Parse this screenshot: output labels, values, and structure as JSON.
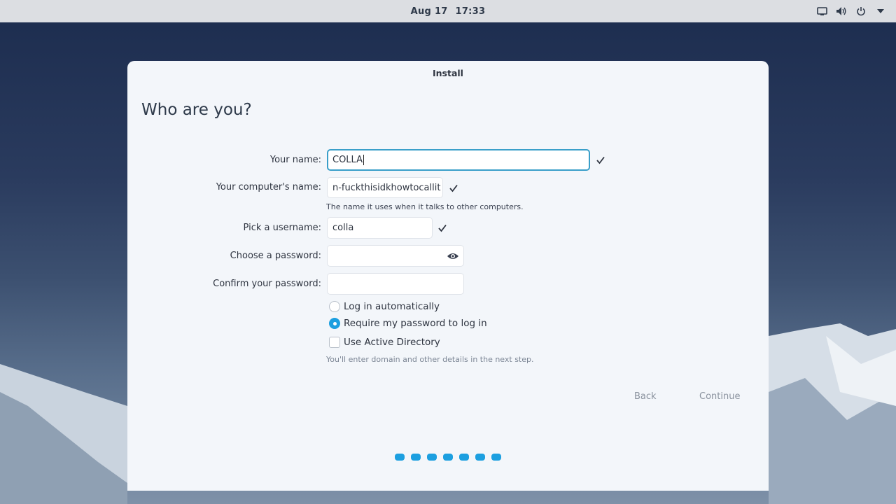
{
  "topbar": {
    "date": "Aug 17",
    "time": "17:33",
    "icons": [
      "display-icon",
      "volume-icon",
      "power-icon",
      "menu-arrow-icon"
    ]
  },
  "window": {
    "title": "Install",
    "heading": "Who are you?"
  },
  "form": {
    "name_label": "Your name:",
    "name_value": "COLLA",
    "computer_label": "Your computer's name:",
    "computer_value": "n-fuckthisidkhowtocallit",
    "computer_hint": "The name it uses when it talks to other computers.",
    "username_label": "Pick a username:",
    "username_value": "colla",
    "password_label": "Choose a password:",
    "password_value": "",
    "confirm_label": "Confirm your password:",
    "confirm_value": "",
    "opt_autologin": "Log in automatically",
    "opt_require_password": "Require my password to log in",
    "opt_active_directory": "Use Active Directory",
    "ad_hint": "You'll enter domain and other details in the next step.",
    "selected_login_option": "Require my password to log in",
    "active_directory_checked": false
  },
  "nav": {
    "back_label": "Back",
    "continue_label": "Continue"
  },
  "progress": {
    "steps": 7
  },
  "colors": {
    "accent": "#1c9fe0",
    "focus_border": "#3a9fc9",
    "window_bg": "#f3f6fa",
    "topbar_bg": "#dcdee2"
  }
}
